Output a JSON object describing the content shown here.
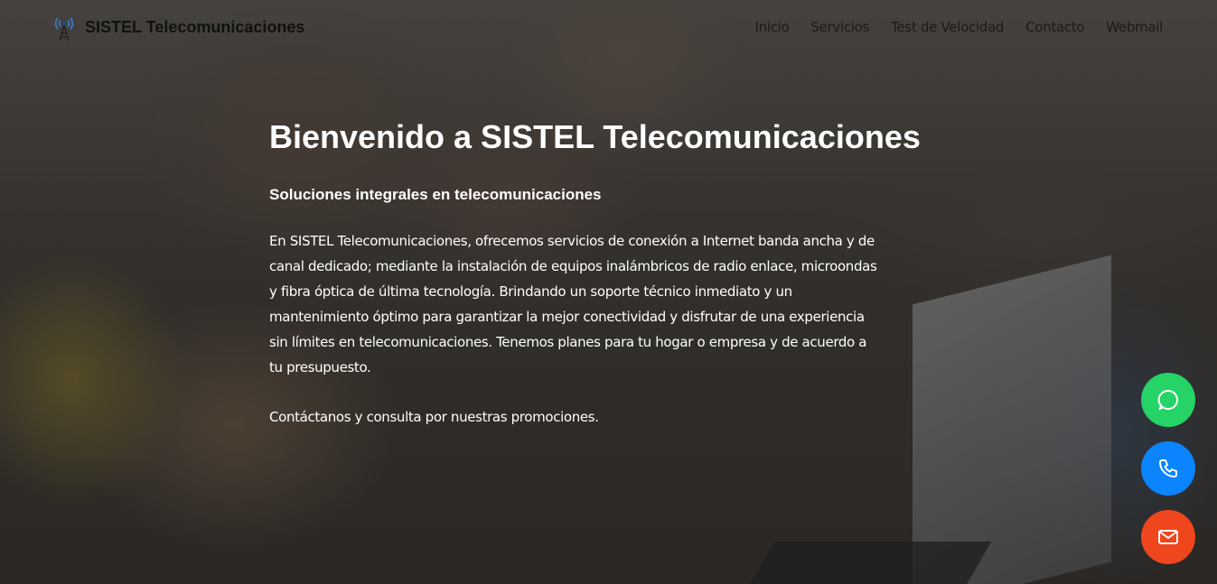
{
  "header": {
    "brand_name": "SISTEL Telecomunicaciones",
    "brand_icon": "antenna-tower-icon",
    "nav": [
      {
        "label": "Inicio"
      },
      {
        "label": "Servicios"
      },
      {
        "label": "Test de Velocidad"
      },
      {
        "label": "Contacto"
      },
      {
        "label": "Webmail"
      }
    ]
  },
  "hero": {
    "title": "Bienvenido a SISTEL Telecomunicaciones",
    "subtitle": "Soluciones integrales en telecomunicaciones",
    "paragraph": "En SISTEL Telecomunicaciones, ofrecemos servicios de conexión a Internet banda ancha y de canal dedicado; mediante la instalación de equipos inalámbricos de radio enlace, microondas y fibra óptica de última tecnología. Brindando un soporte técnico inmediato y un mantenimiento óptimo para garantizar la mejor conectividad y disfrutar de una experiencia sin límites en telecomunicaciones. Tenemos planes para tu hogar o empresa y de acuerdo a tu presupuesto.",
    "cta": "Contáctanos y consulta por nuestras promociones."
  },
  "floating_buttons": [
    {
      "icon": "whatsapp-icon",
      "color": "#25d366"
    },
    {
      "icon": "phone-icon",
      "color": "#0a84ff"
    },
    {
      "icon": "mail-icon",
      "color": "#f0461e"
    }
  ]
}
